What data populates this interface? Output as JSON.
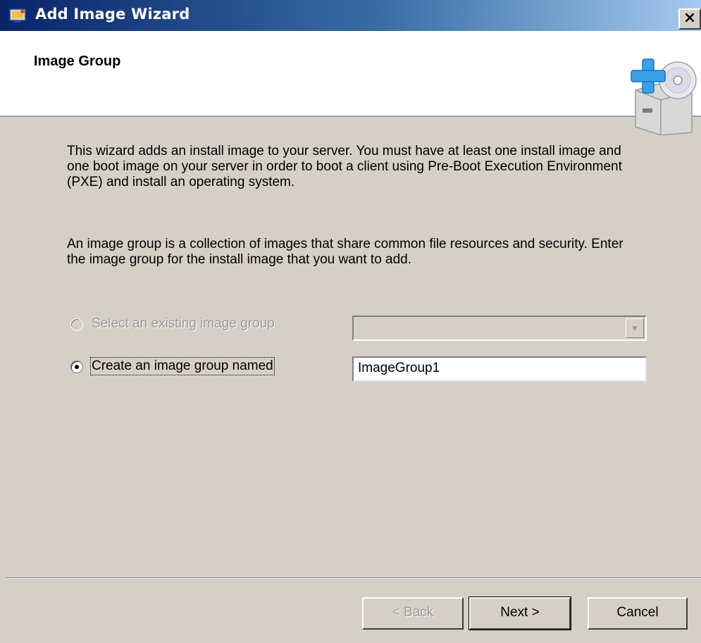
{
  "window": {
    "title": "Add Image Wizard",
    "close_label": "×"
  },
  "header": {
    "title": "Image Group",
    "icon": "image-add-icon"
  },
  "main": {
    "description_1": "This wizard adds an install image to your server. You must have at least one install image and one boot image on your server in order to boot a client using Pre-Boot Execution Environment (PXE) and install an operating system.",
    "description_2": "An image group is a collection of images that share common file resources and security. Enter the image group for the install image that you want to add.",
    "options": [
      {
        "label": "Select an existing image group",
        "selected": false,
        "enabled": false
      },
      {
        "label": "Create an image group named",
        "selected": true,
        "enabled": true
      }
    ],
    "existing_group_value": "",
    "new_group_value": "ImageGroup1"
  },
  "footer": {
    "back_label": "< Back",
    "next_label": "Next >",
    "cancel_label": "Cancel"
  },
  "colors": {
    "titlebar_start": "#0a246a",
    "titlebar_end": "#a6caf0",
    "dialog_bg": "#d4d0c8"
  }
}
